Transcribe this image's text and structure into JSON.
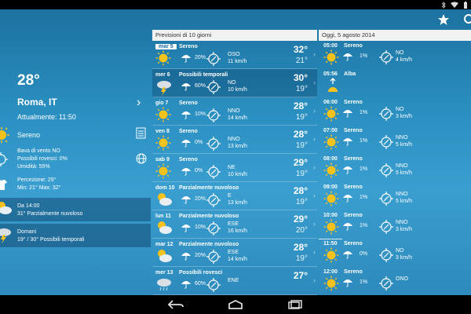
{
  "current": {
    "temperature": "28°",
    "city": "Roma, IT",
    "updated": "Attualmente: 11:50",
    "condition": "Sereno",
    "wind_line": "Bava di vento NO",
    "rain_line": "Possibili rovesci: 0%",
    "humidity_line": "Umidità: 55%",
    "feel_line": "Percezione: 29°",
    "minmax_line": "Min: 21° Max: 32°",
    "later_time": "Da 14:00",
    "later_text": "31° Parzialmente nuvoloso",
    "tomorrow_label": "Domani",
    "tomorrow_text": "19° / 30° Possibili temporali"
  },
  "daily_header": "Previsioni di 10 giorni",
  "hourly_header": "Oggi, 5 agosto 2014",
  "days": [
    {
      "date": "mar 5",
      "cond": "Sereno",
      "icon": "sun-icon",
      "prec": "20%",
      "dir": "OSO",
      "speed": "11 km/h",
      "max": "32°",
      "min": "21°"
    },
    {
      "date": "mer 6",
      "cond": "Possibili temporali",
      "icon": "storm-icon",
      "prec": "60%",
      "dir": "NO",
      "speed": "10 km/h",
      "max": "30°",
      "min": "19°"
    },
    {
      "date": "gio 7",
      "cond": "Sereno",
      "icon": "sun-icon",
      "prec": "10%",
      "dir": "NNO",
      "speed": "14 km/h",
      "max": "28°",
      "min": "19°"
    },
    {
      "date": "ven 8",
      "cond": "Sereno",
      "icon": "sun-icon",
      "prec": "0%",
      "dir": "NNO",
      "speed": "13 km/h",
      "max": "28°",
      "min": "19°"
    },
    {
      "date": "sab 9",
      "cond": "Sereno",
      "icon": "sun-icon",
      "prec": "0%",
      "dir": "NE",
      "speed": "10 km/h",
      "max": "29°",
      "min": "19°"
    },
    {
      "date": "dom 10",
      "cond": "Parzialmente nuvoloso",
      "icon": "partly-cloudy-icon",
      "prec": "20%",
      "dir": "E",
      "speed": "13 km/h",
      "max": "28°",
      "min": "19°"
    },
    {
      "date": "lun 11",
      "cond": "Parzialmente nuvoloso",
      "icon": "partly-cloudy-icon",
      "prec": "10%",
      "dir": "ESE",
      "speed": "16 km/h",
      "max": "29°",
      "min": "20°"
    },
    {
      "date": "mar 12",
      "cond": "Parzialmente nuvoloso",
      "icon": "partly-cloudy-icon",
      "prec": "20%",
      "dir": "ESE",
      "speed": "14 km/h",
      "max": "28°",
      "min": "19°"
    },
    {
      "date": "mer 13",
      "cond": "Possibili rovesci",
      "icon": "rain-icon",
      "prec": "60%",
      "dir": "ENE",
      "speed": "",
      "max": "27°",
      "min": ""
    }
  ],
  "hours": [
    {
      "time": "05:00",
      "cond": "Sereno",
      "icon": "sun-icon",
      "prec": "1%",
      "dir": "NO",
      "speed": "4 km/h"
    },
    {
      "time": "05:56",
      "cond": "Alba",
      "icon": "sunrise-icon",
      "prec": "",
      "dir": "",
      "speed": ""
    },
    {
      "time": "06:00",
      "cond": "Sereno",
      "icon": "sun-icon",
      "prec": "1%",
      "dir": "NO",
      "speed": "3 km/h"
    },
    {
      "time": "07:00",
      "cond": "Sereno",
      "icon": "sun-icon",
      "prec": "1%",
      "dir": "NNO",
      "speed": "5 km/h"
    },
    {
      "time": "08:00",
      "cond": "Sereno",
      "icon": "sun-icon",
      "prec": "1%",
      "dir": "NNO",
      "speed": "5 km/h"
    },
    {
      "time": "09:00",
      "cond": "Sereno",
      "icon": "sun-icon",
      "prec": "1%",
      "dir": "NNO",
      "speed": "5 km/h"
    },
    {
      "time": "10:00",
      "cond": "Sereno",
      "icon": "sun-icon",
      "prec": "1%",
      "dir": "NNO",
      "speed": "3 km/h"
    },
    {
      "time": "11:50",
      "cond": "Sereno",
      "icon": "sun-icon",
      "prec": "0%",
      "dir": "NO",
      "speed": "3 km/h"
    },
    {
      "time": "12:00",
      "cond": "Sereno",
      "icon": "sun-icon",
      "prec": "1%",
      "dir": "ONO",
      "speed": ""
    }
  ]
}
